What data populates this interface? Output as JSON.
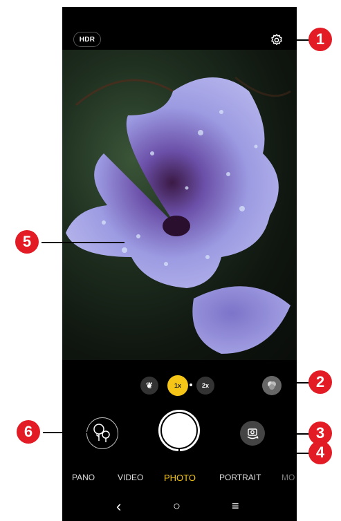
{
  "top_bar": {
    "hdr_label": "HDR",
    "settings_icon": "gear-icon"
  },
  "zoom": {
    "macro_icon": "tulip-icon",
    "levels": [
      "1x",
      "2x"
    ],
    "selected": "1x",
    "filter_icon": "filter-icon"
  },
  "controls": {
    "gallery_icon": "gallery-trees-icon",
    "switch_camera_icon": "switch-camera-icon"
  },
  "modes": {
    "items": [
      "PANO",
      "VIDEO",
      "PHOTO",
      "PORTRAIT",
      "MO"
    ],
    "selected": "PHOTO"
  },
  "nav": {
    "back": "‹",
    "home": "○",
    "menu": "≡"
  },
  "callouts": [
    "1",
    "2",
    "3",
    "4",
    "5",
    "6"
  ],
  "colors": {
    "accent": "#f5c518",
    "callout": "#e21b24",
    "flower": "#9a9ae0"
  }
}
